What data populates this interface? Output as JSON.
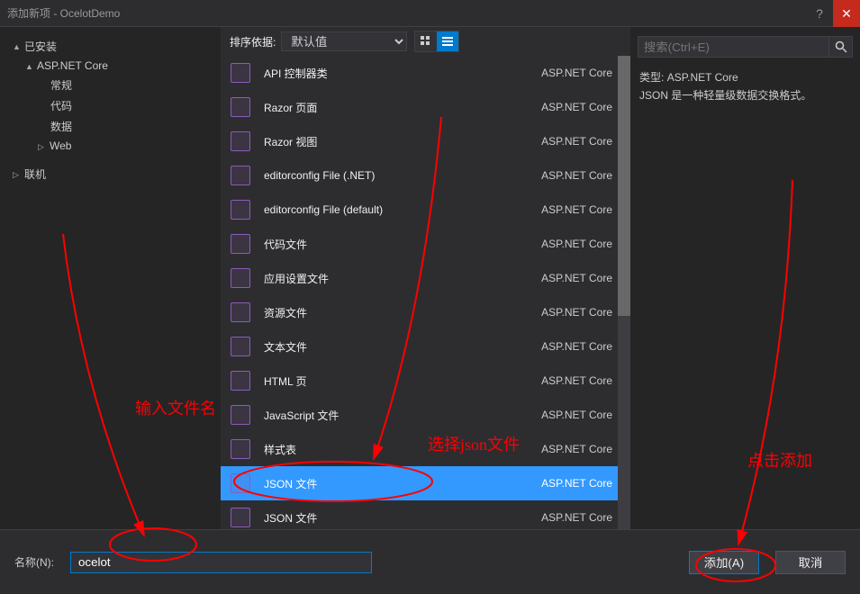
{
  "title": "添加新项 - OcelotDemo",
  "sidebar": {
    "header": "已安装",
    "nodes": [
      {
        "label": "ASP.NET Core",
        "expanded": true,
        "children": [
          {
            "label": "常规"
          },
          {
            "label": "代码"
          },
          {
            "label": "数据"
          },
          {
            "label": "Web",
            "hasCaret": true
          }
        ]
      },
      {
        "label": "联机",
        "hasCaret": true
      }
    ]
  },
  "center": {
    "sort_label": "排序依据:",
    "sort_value": "默认值",
    "items": [
      {
        "label": "API 控制器类",
        "cat": "ASP.NET Core",
        "icon": "ctrl"
      },
      {
        "label": "Razor 页面",
        "cat": "ASP.NET Core",
        "icon": "razor"
      },
      {
        "label": "Razor 视图",
        "cat": "ASP.NET Core",
        "icon": "razor"
      },
      {
        "label": "editorconfig File (.NET)",
        "cat": "ASP.NET Core",
        "icon": "cfg"
      },
      {
        "label": "editorconfig File (default)",
        "cat": "ASP.NET Core",
        "icon": "cfg"
      },
      {
        "label": "代码文件",
        "cat": "ASP.NET Core",
        "icon": "cs"
      },
      {
        "label": "应用设置文件",
        "cat": "ASP.NET Core",
        "icon": "cfg"
      },
      {
        "label": "资源文件",
        "cat": "ASP.NET Core",
        "icon": "res"
      },
      {
        "label": "文本文件",
        "cat": "ASP.NET Core",
        "icon": "txt"
      },
      {
        "label": "HTML 页",
        "cat": "ASP.NET Core",
        "icon": "html"
      },
      {
        "label": "JavaScript 文件",
        "cat": "ASP.NET Core",
        "icon": "js"
      },
      {
        "label": "样式表",
        "cat": "ASP.NET Core",
        "icon": "css"
      },
      {
        "label": "JSON 文件",
        "cat": "ASP.NET Core",
        "icon": "json",
        "selected": true
      },
      {
        "label": "JSON 文件",
        "cat": "ASP.NET Core",
        "icon": "json"
      }
    ]
  },
  "right": {
    "search_placeholder": "搜索(Ctrl+E)",
    "type_label": "类型:",
    "type_value": "ASP.NET Core",
    "desc": "JSON 是一种轻量级数据交换格式。"
  },
  "bottom": {
    "name_label": "名称(N):",
    "name_value": "ocelot",
    "add_label": "添加(A)",
    "cancel_label": "取消"
  },
  "annotations": {
    "a1": "输入文件名",
    "a2": "选择json文件",
    "a3": "点击添加"
  }
}
